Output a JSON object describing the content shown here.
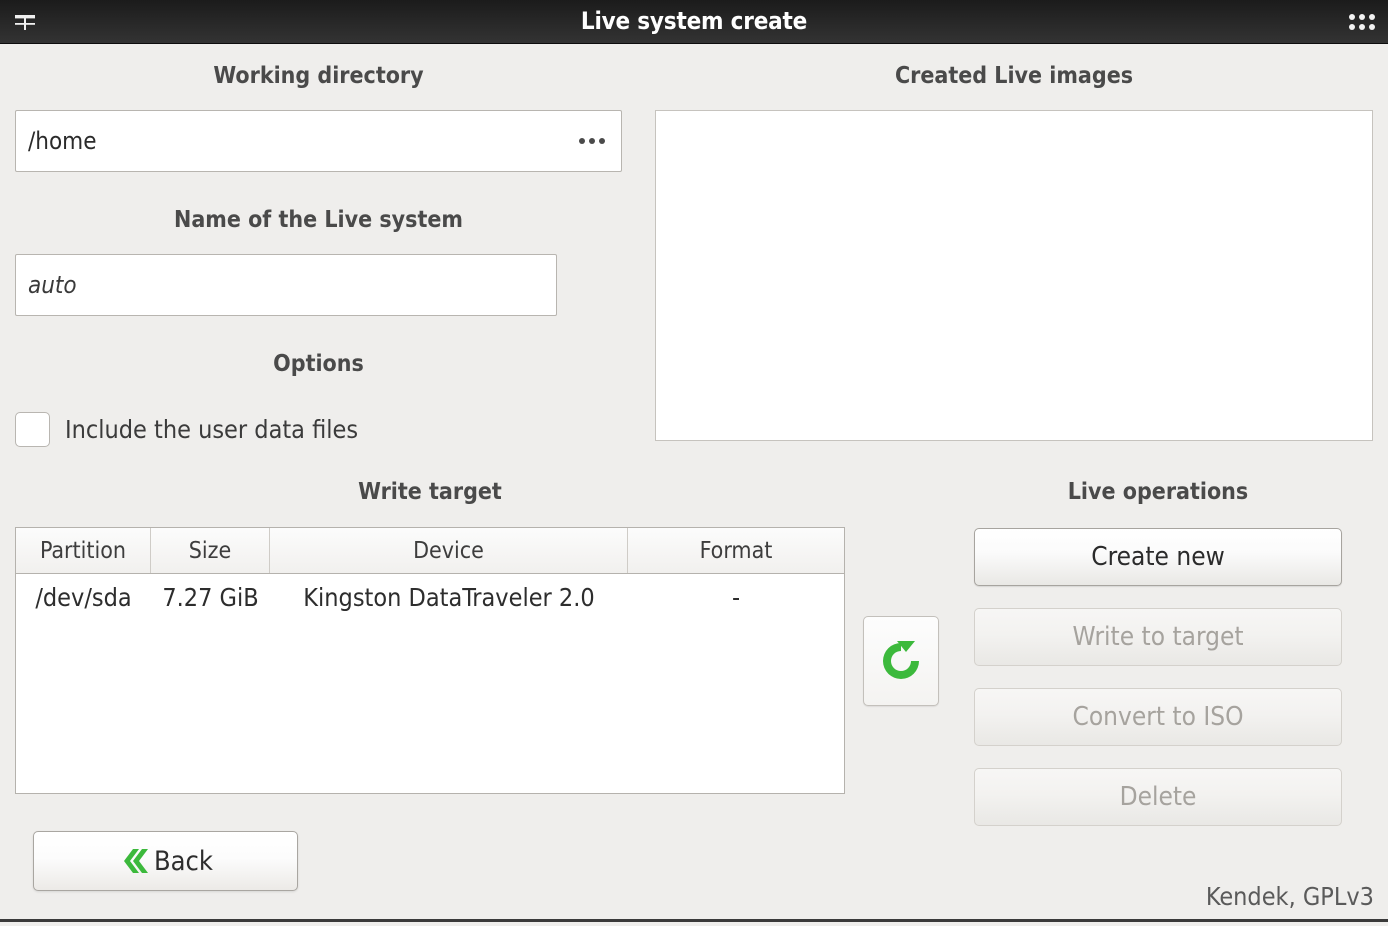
{
  "window": {
    "title": "Live system create",
    "menu_icon": "hamburger-align-icon",
    "apps_icon": "apps-grid-icon"
  },
  "working_directory": {
    "title": "Working directory",
    "value": "/home",
    "browse_icon": "ellipsis-icon"
  },
  "live_name": {
    "title": "Name of the Live system",
    "value": "",
    "placeholder": "auto"
  },
  "options": {
    "title": "Options",
    "items": [
      {
        "label": "Include the user data files",
        "checked": false
      }
    ]
  },
  "created_images": {
    "title": "Created Live images",
    "items": []
  },
  "write_target": {
    "title": "Write target",
    "columns": [
      "Partition",
      "Size",
      "Device",
      "Format"
    ],
    "rows": [
      {
        "partition": "/dev/sda",
        "size": "7.27 GiB",
        "device": "Kingston DataTraveler 2.0",
        "format": "-"
      }
    ],
    "refresh_icon": "refresh-circular-arrow-icon"
  },
  "live_operations": {
    "title": "Live operations",
    "buttons": [
      {
        "label": "Create new",
        "enabled": true
      },
      {
        "label": "Write to target",
        "enabled": false
      },
      {
        "label": "Convert to ISO",
        "enabled": false
      },
      {
        "label": "Delete",
        "enabled": false
      }
    ]
  },
  "navigation": {
    "back_label": "Back",
    "back_icon": "double-chevron-left-icon"
  },
  "footer": {
    "text": "Kendek, GPLv3"
  },
  "colors": {
    "accent_green": "#3cb93c",
    "window_background": "#efeeec",
    "titlebar": "#262626"
  }
}
